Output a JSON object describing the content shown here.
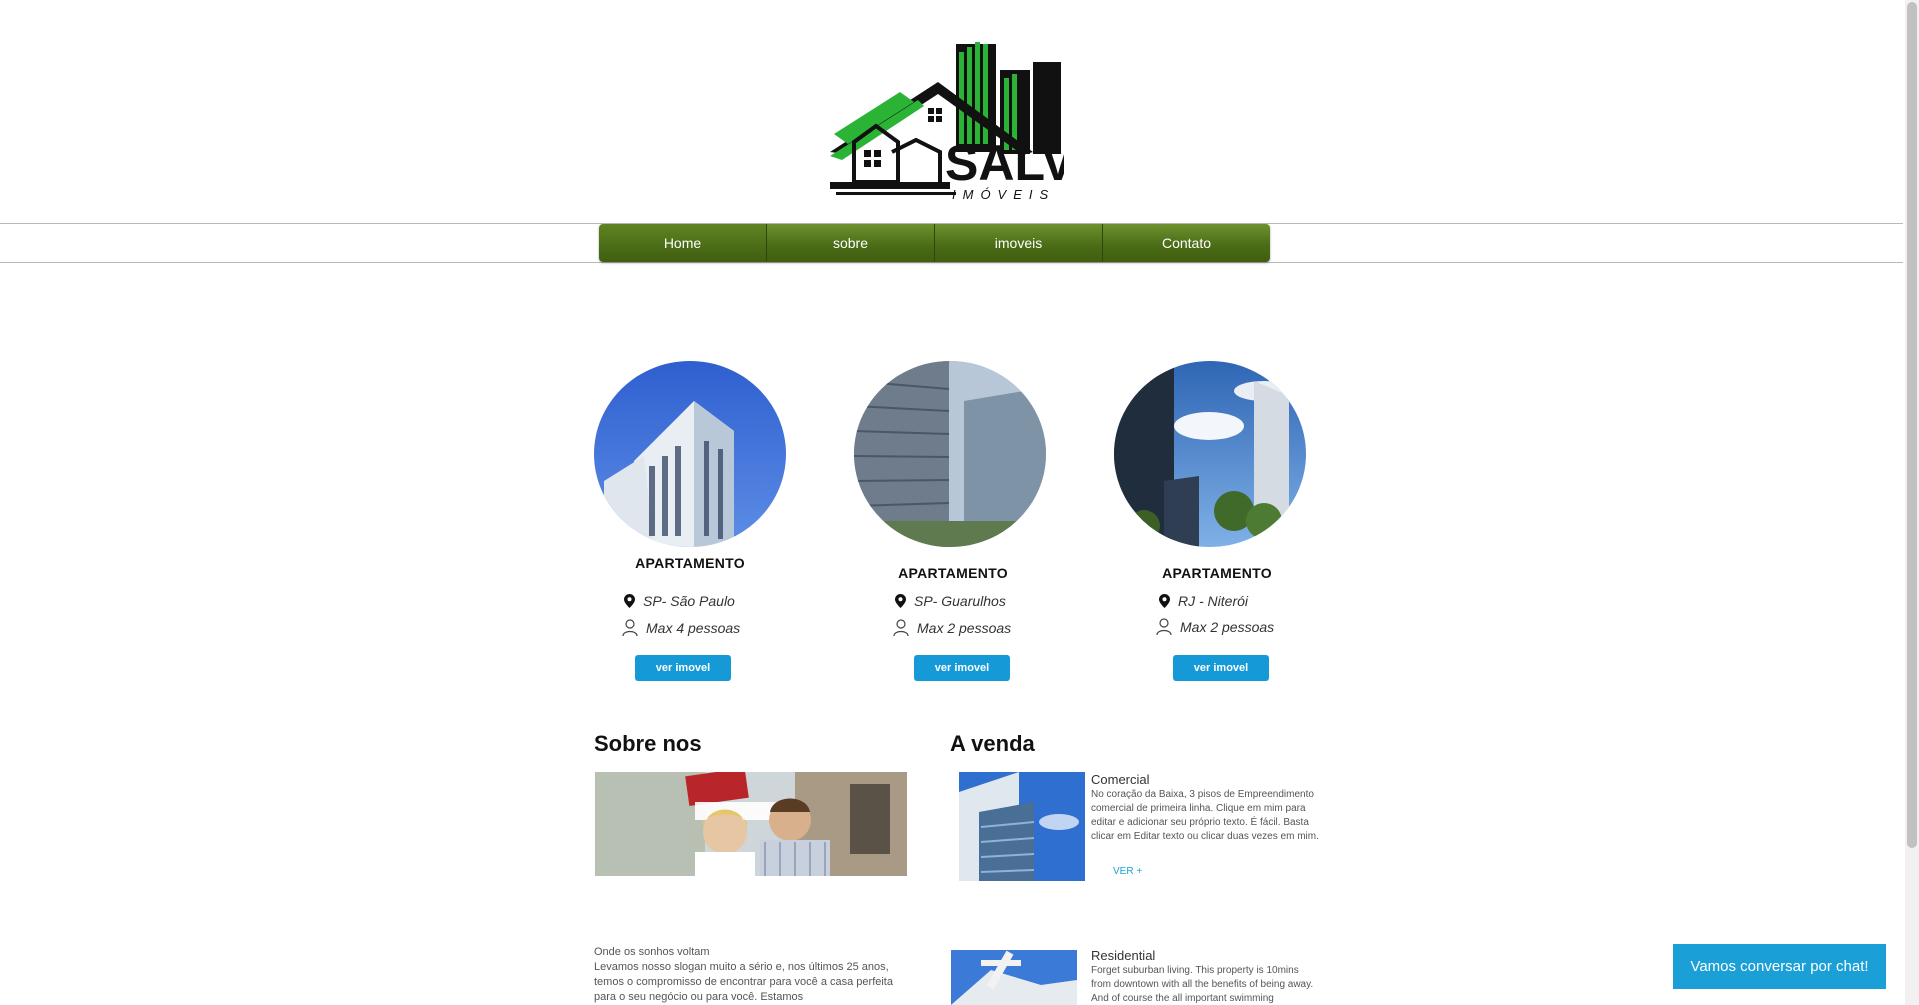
{
  "brand": {
    "name": "SALVO",
    "subtitle": "IMÓVEIS",
    "colors": {
      "green": "#2bb336",
      "black": "#111111"
    }
  },
  "nav": {
    "items": [
      {
        "label": "Home"
      },
      {
        "label": "sobre"
      },
      {
        "label": "imoveis"
      },
      {
        "label": "Contato"
      }
    ],
    "active_index": 0
  },
  "properties": [
    {
      "type": "APARTAMENTO",
      "location": "SP- São Paulo",
      "capacity": "Max 4 pessoas",
      "button": "ver imovel"
    },
    {
      "type": "APARTAMENTO",
      "location": "SP- Guarulhos",
      "capacity": "Max 2 pessoas",
      "button": "ver imovel"
    },
    {
      "type": "APARTAMENTO",
      "location": "RJ - Niterói",
      "capacity": "Max 2 pessoas",
      "button": "ver imovel"
    }
  ],
  "about": {
    "title": "Sobre nos",
    "lead": "Onde os sonhos voltam",
    "body": "Levamos nosso slogan muito a sério e, nos últimos 25 anos, temos o compromisso de encontrar para você a casa perfeita para o seu negócio ou para você. Estamos"
  },
  "for_sale": {
    "title": "A venda",
    "listings": [
      {
        "title": "Comercial",
        "description": "No coração da Baixa, 3 pisos de Empreendimento comercial de primeira linha. Clique em mim para editar e adicionar seu próprio texto. É fácil. Basta clicar em Editar texto ou clicar duas vezes em mim.",
        "link": "VER +"
      },
      {
        "title": "Residential",
        "description": "Forget suburban living. This property is 10mins from downtown with all the benefits of being away. And of course the all important swimming",
        "link": ""
      }
    ]
  },
  "chat": {
    "label": "Vamos conversar por chat!"
  },
  "icons": {
    "location": "map-pin-icon",
    "capacity": "person-icon"
  }
}
